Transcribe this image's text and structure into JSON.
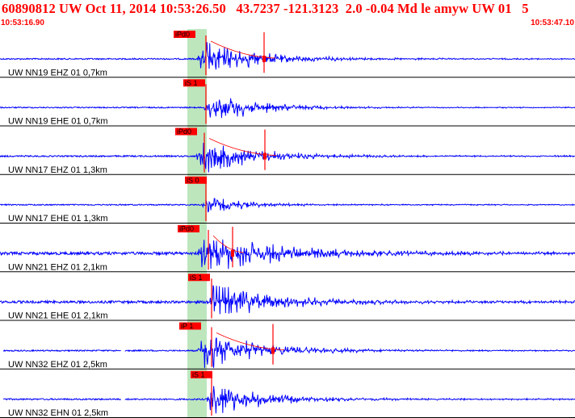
{
  "header": {
    "title": "60890812 UW Oct 11, 2014 10:53:26.50   43.7237 -121.3123  2.0 -0.04 Md le amyw UW 01   5",
    "start_time": "10:53:16.90",
    "end_time": "10:53:47.10"
  },
  "colors": {
    "trace": "#0000ff",
    "pick": "#ff0000",
    "window": "#bde6bd",
    "header_text": "#ff0000"
  },
  "traces": [
    {
      "label": "UW NN19 EHZ 01 0,7km",
      "pick_label": "iPd0",
      "amplitude": 1.0,
      "has_coda_pick": true
    },
    {
      "label": "UW NN19 EHE 01 0,7km",
      "pick_label": "iS 1",
      "amplitude": 0.85,
      "has_coda_pick": false
    },
    {
      "label": "UW NN17 EHZ 01 1,3km",
      "pick_label": "iPd0",
      "amplitude": 0.95,
      "has_coda_pick": true
    },
    {
      "label": "UW NN17 EHE 01 1,3km",
      "pick_label": "iS 0",
      "amplitude": 0.45,
      "has_coda_pick": false
    },
    {
      "label": "UW NN21 EHZ 01 2,1km",
      "pick_label": "iPd0",
      "amplitude": 1.0,
      "has_coda_pick": true
    },
    {
      "label": "UW NN21 EHE 01 2,1km",
      "pick_label": "iS 1",
      "amplitude": 0.9,
      "has_coda_pick": false
    },
    {
      "label": "UW NN32 EHZ 01 2,5km",
      "pick_label": "iP 1",
      "amplitude": 0.95,
      "has_coda_pick": true
    },
    {
      "label": "UW NN32 EHN 01 2,5km",
      "pick_label": "iS 1",
      "amplitude": 0.95,
      "has_coda_pick": false
    }
  ]
}
